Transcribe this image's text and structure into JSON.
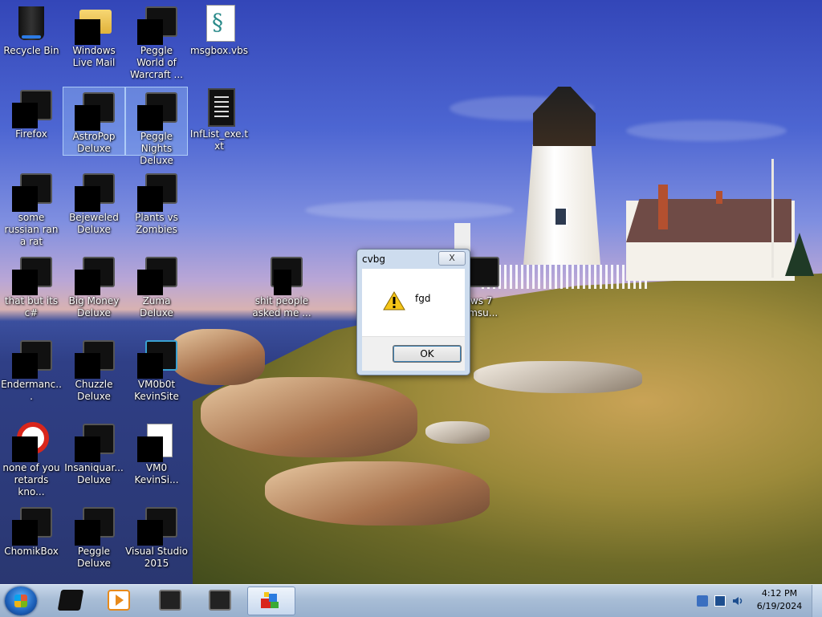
{
  "desktop": {
    "icons": [
      {
        "label": "Recycle Bin",
        "kind": "recycle-bin-icon"
      },
      {
        "label": "Windows Live Mail",
        "kind": "app-icon"
      },
      {
        "label": "Peggle World of Warcraft ...",
        "kind": "app-icon"
      },
      {
        "label": "msgbox.vbs",
        "kind": "script-file-icon"
      },
      {
        "label": "Firefox",
        "kind": "app-icon"
      },
      {
        "label": "AstroPop Deluxe",
        "kind": "app-icon"
      },
      {
        "label": "Peggle Nights Deluxe",
        "kind": "app-icon"
      },
      {
        "label": "InfList_exe.txt",
        "kind": "text-file-icon"
      },
      {
        "label": "some russian ran a rat",
        "kind": "app-icon"
      },
      {
        "label": "Bejeweled Deluxe",
        "kind": "app-icon"
      },
      {
        "label": "Plants vs Zombies",
        "kind": "app-icon"
      },
      {
        "label": "that but its c#",
        "kind": "app-icon"
      },
      {
        "label": "Big Money Deluxe",
        "kind": "app-icon"
      },
      {
        "label": "Zuma Deluxe",
        "kind": "app-icon"
      },
      {
        "label": "shit people asked me ...",
        "kind": "app-icon"
      },
      {
        "label": "ows 7 ...msu...",
        "kind": "app-icon"
      },
      {
        "label": "Endermanc...",
        "kind": "app-icon"
      },
      {
        "label": "Chuzzle Deluxe",
        "kind": "app-icon"
      },
      {
        "label": "VM0b0t KevinSite",
        "kind": "app-icon"
      },
      {
        "label": "none of you retards kno...",
        "kind": "app-icon"
      },
      {
        "label": "Insaniquar... Deluxe",
        "kind": "app-icon"
      },
      {
        "label": "VM0 KevinSi...",
        "kind": "document-icon"
      },
      {
        "label": "ChomikBox",
        "kind": "app-icon"
      },
      {
        "label": "Peggle Deluxe",
        "kind": "app-icon"
      },
      {
        "label": "Visual Studio 2015",
        "kind": "app-icon"
      }
    ]
  },
  "dialog": {
    "title": "cvbg",
    "close_label": "X",
    "message": "fgd",
    "ok_label": "OK",
    "icon": "warning-icon"
  },
  "taskbar": {
    "items": [
      {
        "name": "explorer-taskbar-icon"
      },
      {
        "name": "media-player-taskbar-icon"
      },
      {
        "name": "app-taskbar-icon-1"
      },
      {
        "name": "app-taskbar-icon-2"
      },
      {
        "name": "script-host-taskbar-icon"
      }
    ],
    "time": "4:12 PM",
    "date": "6/19/2024"
  },
  "colors": {
    "taskbar": "#a8bdd6",
    "dialog_frame": "#cddcee",
    "selection": "#aad2ff"
  }
}
